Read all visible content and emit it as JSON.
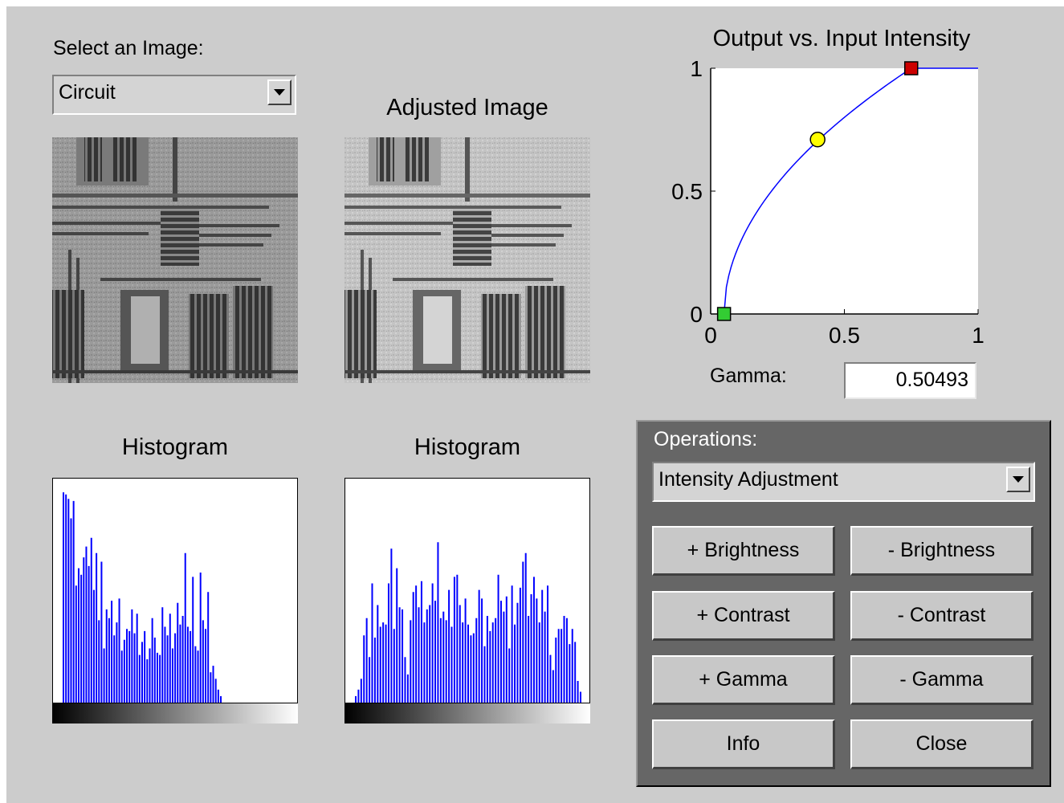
{
  "select_image": {
    "label": "Select an Image:",
    "value": "Circuit"
  },
  "adjusted_title": "Adjusted Image",
  "histograms": [
    {
      "title": "Histogram",
      "values": [
        0.97,
        0.96,
        0.94,
        0.85,
        0.93,
        0.54,
        0.62,
        0.59,
        0.67,
        0.72,
        0.63,
        0.76,
        0.52,
        0.69,
        0.38,
        0.65,
        0.25,
        0.43,
        0.39,
        0.47,
        0.31,
        0.37,
        0.48,
        0.24,
        0.29,
        0.34,
        0.33,
        0.43,
        0.32,
        0.41,
        0.22,
        0.28,
        0.33,
        0.2,
        0.25,
        0.39,
        0.3,
        0.23,
        0.22,
        0.44,
        0.35,
        0.31,
        0.41,
        0.25,
        0.32,
        0.46,
        0.36,
        0.4,
        0.69,
        0.35,
        0.33,
        0.58,
        0.26,
        0.24,
        0.6,
        0.38,
        0.34,
        0.51,
        0.14,
        0.17,
        0.11,
        0.06,
        0.03
      ]
    },
    {
      "title": "Histogram",
      "values": [
        0.03,
        0.06,
        0.11,
        0.31,
        0.39,
        0.21,
        0.55,
        0.3,
        0.45,
        0.35,
        0.37,
        0.36,
        0.55,
        0.71,
        0.34,
        0.62,
        0.44,
        0.43,
        0.21,
        0.13,
        0.38,
        0.51,
        0.54,
        0.44,
        0.56,
        0.37,
        0.43,
        0.45,
        0.55,
        0.47,
        0.74,
        0.39,
        0.42,
        0.38,
        0.52,
        0.35,
        0.58,
        0.59,
        0.45,
        0.37,
        0.48,
        0.36,
        0.31,
        0.32,
        0.39,
        0.52,
        0.48,
        0.26,
        0.4,
        0.33,
        0.37,
        0.39,
        0.59,
        0.47,
        0.42,
        0.49,
        0.25,
        0.54,
        0.36,
        0.46,
        0.53,
        0.65,
        0.69,
        0.4,
        0.5,
        0.58,
        0.48,
        0.37,
        0.52,
        0.42,
        0.54,
        0.22,
        0.15,
        0.3,
        0.34,
        0.34,
        0.4,
        0.39,
        0.27,
        0.34,
        0.28,
        0.1,
        0.05
      ]
    }
  ],
  "curve": {
    "title": "Output vs. Input Intensity",
    "x_ticks": [
      "0",
      "0.5",
      "1"
    ],
    "y_ticks": [
      "0",
      "0.5",
      "1"
    ],
    "low_in": 0.05,
    "high_in": 0.75,
    "low_out": 0,
    "high_out": 1,
    "gamma": 0.50493,
    "mid_point": [
      0.4,
      0.71
    ],
    "line_color": "#0000ff",
    "handle_colors": {
      "low": "#33cc33",
      "mid": "#ffff00",
      "high": "#cc0000"
    }
  },
  "gamma_field": {
    "label": "Gamma:",
    "value": "0.50493"
  },
  "operations": {
    "label": "Operations:",
    "value": "Intensity Adjustment",
    "buttons": {
      "plus_brightness": "+ Brightness",
      "minus_brightness": "- Brightness",
      "plus_contrast": "+ Contrast",
      "minus_contrast": "- Contrast",
      "plus_gamma": "+ Gamma",
      "minus_gamma": "- Gamma",
      "info": "Info",
      "close": "Close"
    }
  },
  "colors": {
    "window_bg": "#cccccc",
    "panel_bg": "#666666",
    "histogram_bar": "#0000ff"
  }
}
